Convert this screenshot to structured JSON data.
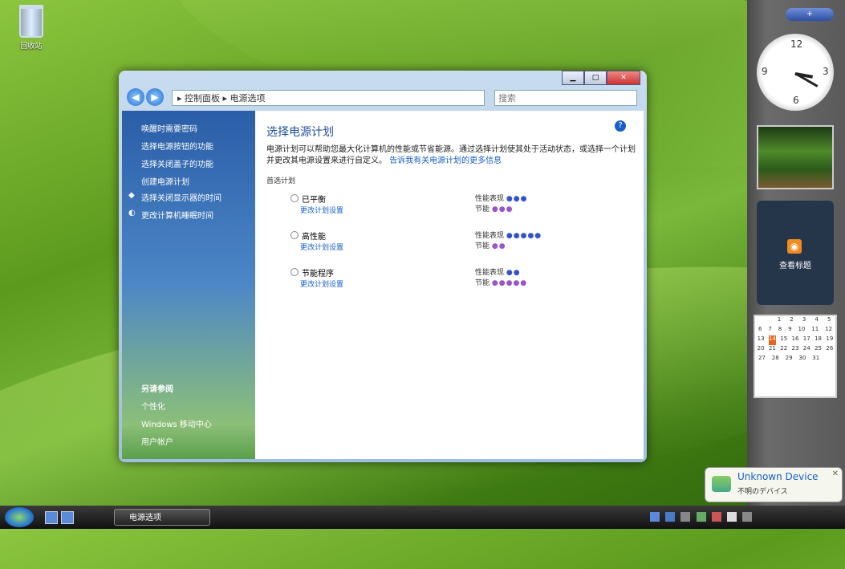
{
  "desktop": {
    "recycle_bin_label": "回收站"
  },
  "window": {
    "buttons": {
      "minimize": "▁",
      "maximize": "□",
      "close": "✕"
    },
    "address": {
      "back": "◀",
      "forward": "▶",
      "breadcrumb": "▸ 控制面板 ▸ 电源选项",
      "search_placeholder": "搜索"
    },
    "nav_pane": {
      "items": [
        "唤醒时需要密码",
        "选择电源按钮的功能",
        "选择关闭盖子的功能",
        "创建电源计划",
        "选择关闭显示器的时间",
        "更改计算机睡眠时间"
      ],
      "see_also_title": "另请参阅",
      "see_also_items": [
        "个性化",
        "Windows 移动中心",
        "用户帐户"
      ]
    },
    "main": {
      "title": "选择电源计划",
      "description": "电源计划可以帮助您最大化计算机的性能或节省能源。通过选择计划使其处于活动状态，或选择一个计划并更改其电源设置来进行自定义。",
      "description_link": "告诉我有关电源计划的更多信息",
      "section_label": "首选计划",
      "plans": [
        {
          "name": "已平衡",
          "link": "更改计划设置",
          "perf_label": "性能表现",
          "perf": "●●●",
          "save_label": "节能",
          "save": "●●●"
        },
        {
          "name": "高性能",
          "link": "更改计划设置",
          "perf_label": "性能表现",
          "perf": "●●●●●",
          "save_label": "节能",
          "save": "●●"
        },
        {
          "name": "节能程序",
          "link": "更改计划设置",
          "perf_label": "性能表现",
          "perf": "●●",
          "save_label": "节能",
          "save": "●●●●●"
        }
      ],
      "help_icon": "?"
    }
  },
  "sidebar": {
    "toggle": "+",
    "clock_numbers": [
      "12",
      "3",
      "6",
      "9"
    ],
    "feed_label": "查看标题",
    "calendar": {
      "header": "",
      "rows": [
        [
          "",
          "",
          "",
          "",
          "",
          "",
          ""
        ],
        [
          "",
          "",
          "1",
          "2",
          "3",
          "4",
          "5"
        ],
        [
          "6",
          "7",
          "8",
          "9",
          "10",
          "11",
          "12"
        ],
        [
          "13",
          "14",
          "15",
          "16",
          "17",
          "18",
          "19"
        ],
        [
          "20",
          "21",
          "22",
          "23",
          "24",
          "25",
          "26"
        ],
        [
          "27",
          "28",
          "29",
          "30",
          "31",
          "",
          ""
        ]
      ]
    }
  },
  "taskbar": {
    "task_button": "电源选项",
    "clock": ""
  },
  "balloon": {
    "title": "Unknown Device",
    "subtitle": "不明のデバイス",
    "close": "✕"
  }
}
